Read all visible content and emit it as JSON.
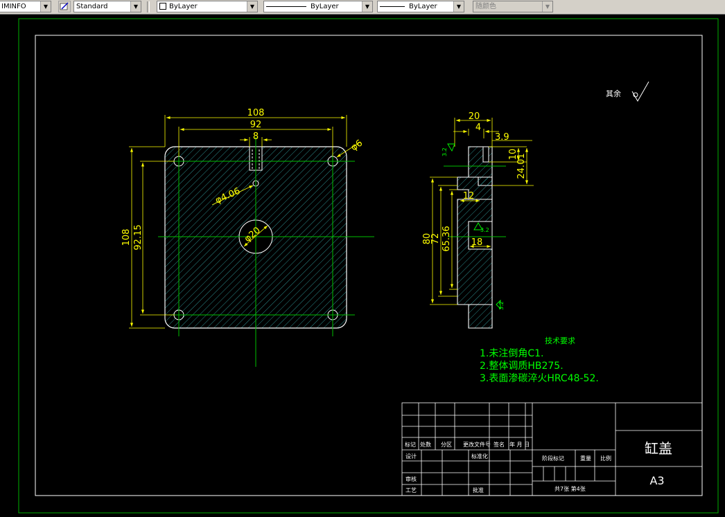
{
  "toolbar": {
    "dim_style": "IMINFO",
    "text_style": "Standard",
    "layer": "ByLayer",
    "linetype": "ByLayer",
    "lineweight": "ByLayer",
    "color": "随颜色"
  },
  "drawing": {
    "roughness_other": "其余",
    "front_dims": {
      "width_outer": "108",
      "width_holes": "92",
      "slot_width": "8",
      "hole_dia": "φ6",
      "small_hole": "φ4.06",
      "center_hole": "φ20",
      "height_outer": "108",
      "height_holes": "92.15"
    },
    "side_dims": {
      "d20": "20",
      "d4": "4",
      "d39": "3.9",
      "d10": "10",
      "d24": "24.01",
      "d12": "12",
      "d80": "80",
      "d72": "72",
      "d65": "65.36",
      "d18": "18",
      "rough_a": "3.2",
      "rough_b": "3.2",
      "rough_c": "3.2"
    },
    "tech_title": "技术要求",
    "tech_items": [
      "1.未注倒角C1.",
      "2.整体调质HB275.",
      "3.表面渗碳淬火HRC48-52."
    ]
  },
  "title_block": {
    "part_name": "缸盖",
    "paper_size": "A3",
    "headers": [
      "标记",
      "处数",
      "分区",
      "更改文件号",
      "签名",
      "年 月 日"
    ],
    "design": "设计",
    "standardize": "标准化",
    "review": "审核",
    "process": "工艺",
    "approve": "批准",
    "stage_mark": "阶段标记",
    "weight": "重量",
    "scale": "比例",
    "sheets": "共7张 第4张"
  }
}
